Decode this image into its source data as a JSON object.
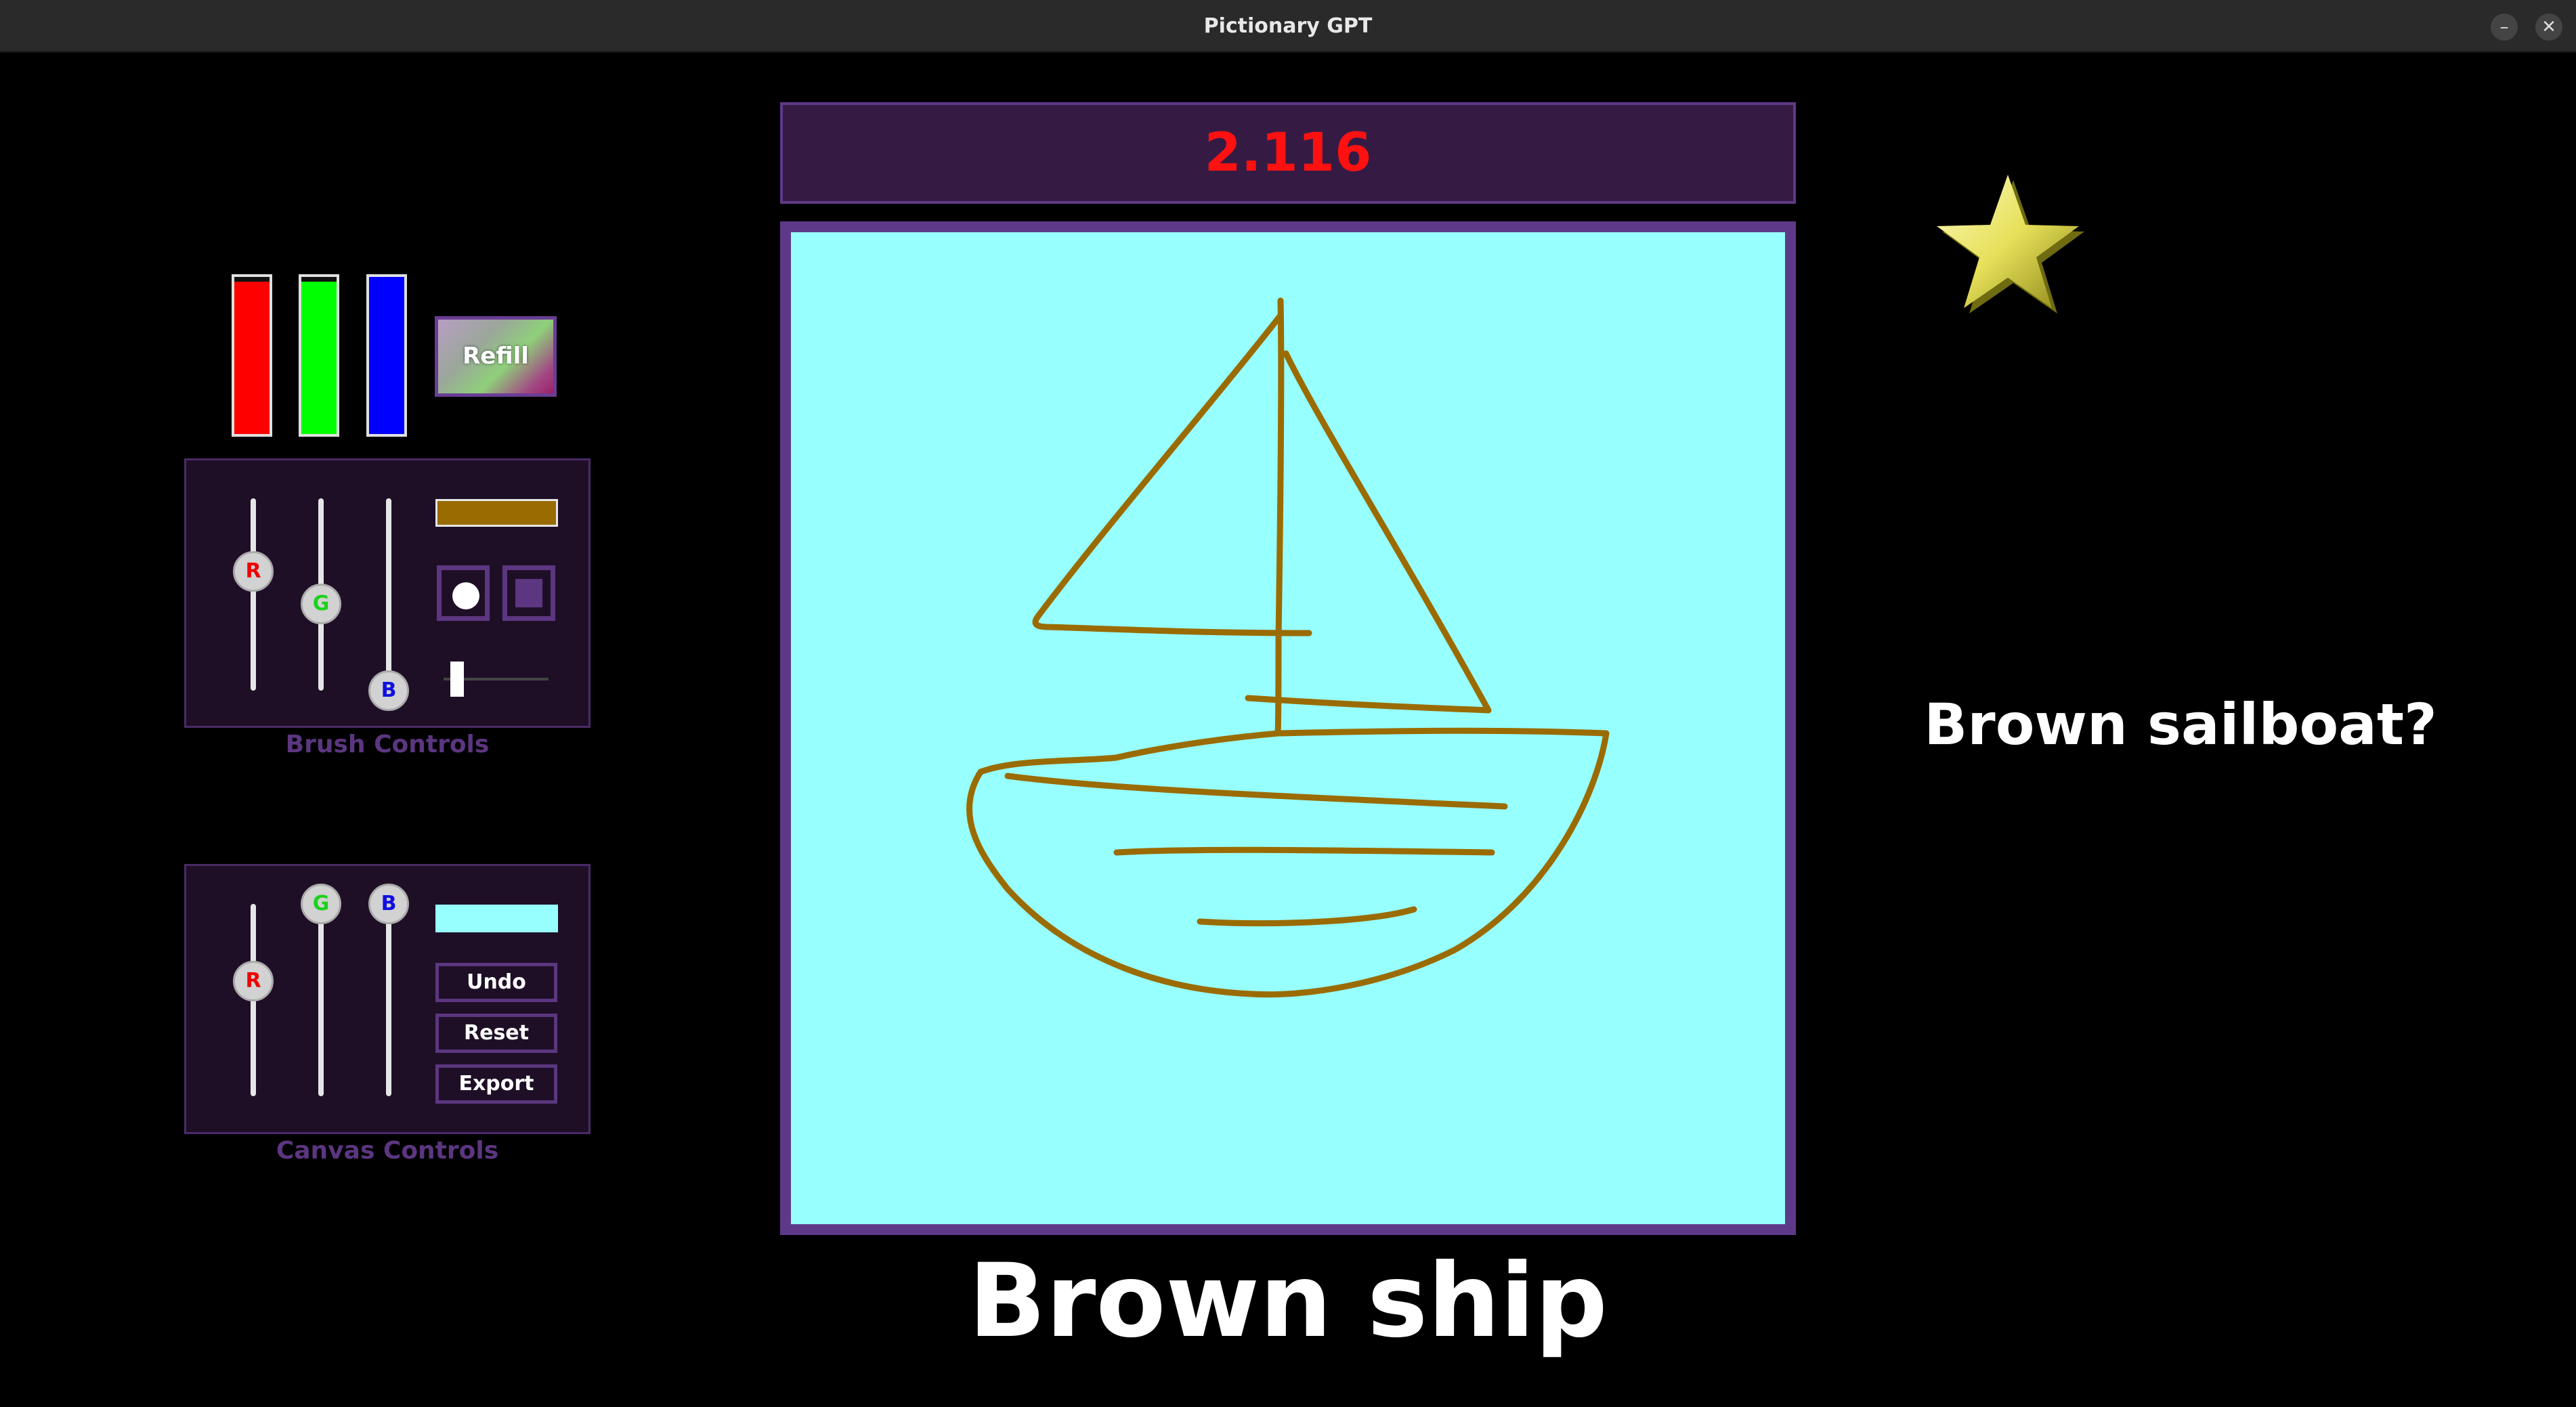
{
  "window": {
    "title": "Pictionary GPT",
    "minimize_glyph": "–",
    "close_glyph": "✕"
  },
  "paint_meters": [
    {
      "name": "red",
      "color": "#ff0000",
      "level": 0.97
    },
    {
      "name": "green",
      "color": "#00ff00",
      "level": 0.97
    },
    {
      "name": "blue",
      "color": "#0000ff",
      "level": 1.0
    }
  ],
  "refill_label": "Refill",
  "brush_controls": {
    "label": "Brush Controls",
    "sliders": {
      "r_label": "R",
      "g_label": "G",
      "b_label": "B",
      "r": 0.62,
      "g": 0.45,
      "b": 0.0
    },
    "color_preview": "#9a6b00",
    "shapes": [
      "round-brush-icon",
      "square-brush-icon"
    ],
    "size_level": 0.1
  },
  "canvas_controls": {
    "label": "Canvas Controls",
    "sliders": {
      "r_label": "R",
      "g_label": "G",
      "b_label": "B",
      "r": 0.6,
      "g": 1.0,
      "b": 1.0
    },
    "color_preview": "#98ffff",
    "undo_label": "Undo",
    "reset_label": "Reset",
    "export_label": "Export"
  },
  "score": "2.116",
  "canvas_background": "#98ffff",
  "stroke_color": "#9a6b00",
  "answer": "Brown ship",
  "guess": "Brown sailboat?",
  "star_icon": "gold-star-icon"
}
